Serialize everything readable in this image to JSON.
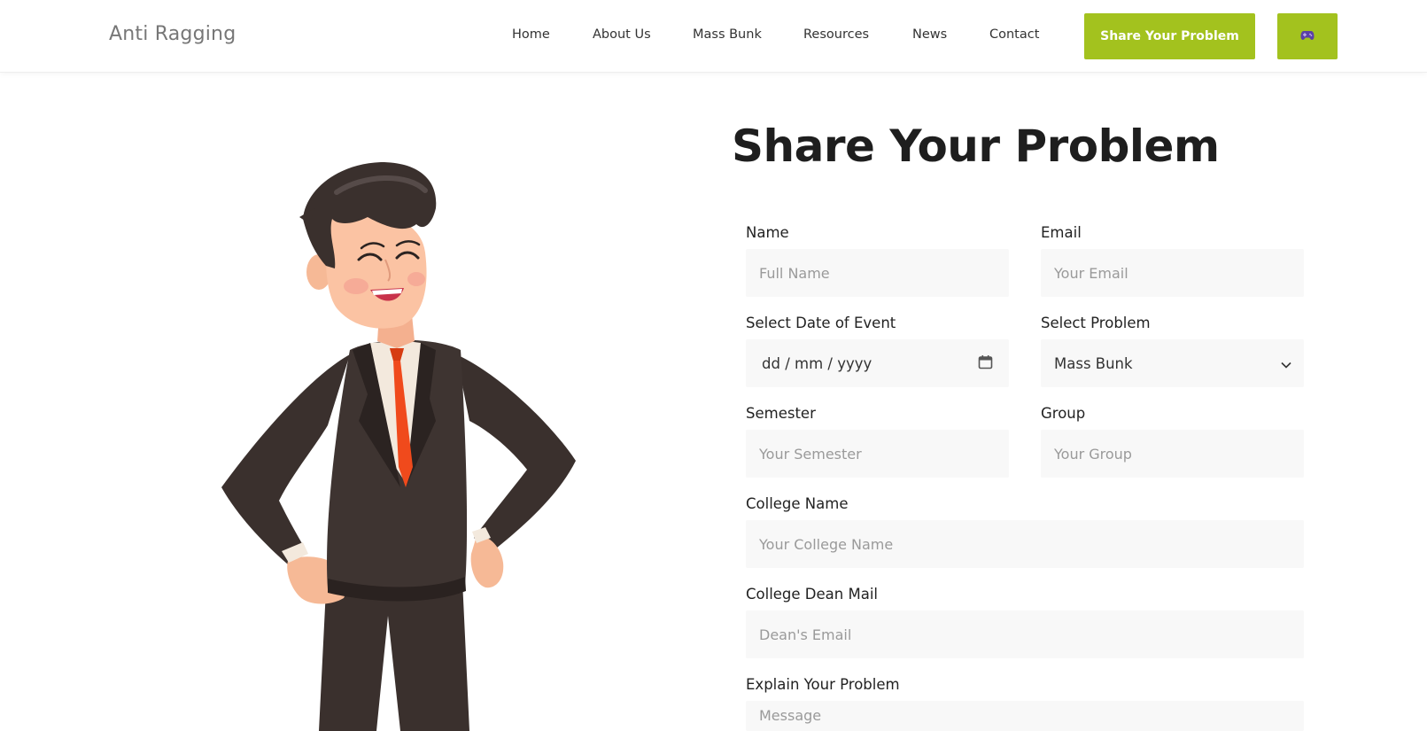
{
  "brand": "Anti Ragging",
  "nav": {
    "links": [
      "Home",
      "About Us",
      "Mass Bunk",
      "Resources",
      "News",
      "Contact"
    ],
    "cta_label": "Share Your Problem",
    "game_icon": "gamepad-icon",
    "accent": "#a3c21e"
  },
  "form": {
    "title": "Share Your Problem",
    "name": {
      "label": "Name",
      "placeholder": "Full Name"
    },
    "email": {
      "label": "Email",
      "placeholder": "Your Email"
    },
    "date": {
      "label": "Select Date of Event",
      "value": "dd / mm / yyyy"
    },
    "problem": {
      "label": "Select Problem",
      "selected": "Mass Bunk"
    },
    "semester": {
      "label": "Semester",
      "placeholder": "Your Semester"
    },
    "group": {
      "label": "Group",
      "placeholder": "Your Group"
    },
    "college": {
      "label": "College Name",
      "placeholder": "Your College Name"
    },
    "dean": {
      "label": "College Dean Mail",
      "placeholder": "Dean's Email"
    },
    "message": {
      "label": "Explain Your Problem",
      "placeholder": "Message"
    }
  }
}
